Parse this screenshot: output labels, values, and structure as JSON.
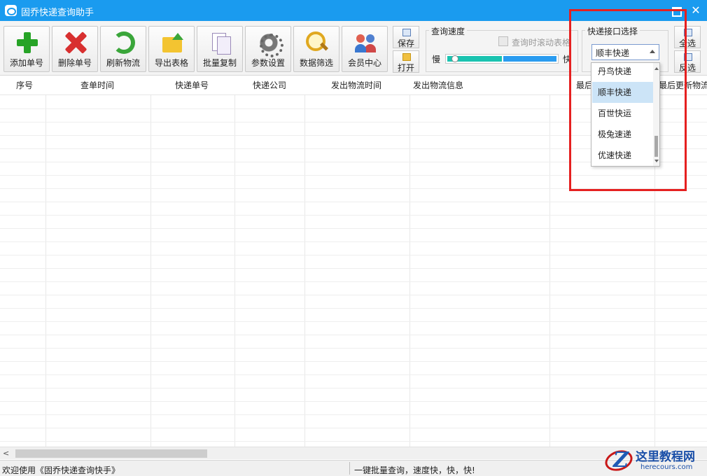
{
  "window": {
    "title": "固乔快递查询助手",
    "minimize_glyph": "",
    "maximize_glyph": "",
    "close_glyph": "✕"
  },
  "toolbar": {
    "buttons": [
      {
        "label": "添加单号",
        "icon": "add-icon"
      },
      {
        "label": "删除单号",
        "icon": "delete-icon"
      },
      {
        "label": "刷新物流",
        "icon": "refresh-icon"
      },
      {
        "label": "导出表格",
        "icon": "export-icon"
      },
      {
        "label": "批量复制",
        "icon": "copy-icon"
      },
      {
        "label": "参数设置",
        "icon": "gear-icon"
      },
      {
        "label": "数据筛选",
        "icon": "search-icon"
      },
      {
        "label": "会员中心",
        "icon": "member-icon"
      }
    ],
    "save_label": "保存",
    "open_label": "打开"
  },
  "query_speed": {
    "title": "查询速度",
    "scroll_checkbox_label": "查询时滚动表格",
    "scroll_checked": false,
    "slow_label": "慢",
    "fast_label": "快",
    "speed_fraction": 0.05
  },
  "courier_api": {
    "title": "快递接口选择",
    "selected": "顺丰快递",
    "options": [
      "丹鸟快递",
      "顺丰快递",
      "百世快运",
      "极兔速递",
      "优速快递"
    ],
    "select_all_label": "全选",
    "invert_label": "反选"
  },
  "table": {
    "columns": [
      "序号",
      "查单时间",
      "快递单号",
      "快递公司",
      "发出物流时间",
      "发出物流信息",
      "最后",
      "最后更新物流"
    ],
    "rows": []
  },
  "scrollbar": {
    "left_arrow": "<"
  },
  "status": {
    "left": "欢迎使用《固乔快递查询快手》",
    "right": "一键批量查询，速度快，快，快!"
  },
  "watermark": {
    "logo_letter": "Z",
    "title": "这里教程网",
    "url": "herecours.com"
  },
  "colors": {
    "title_bar": "#1a9bef",
    "highlight_box": "#e52020",
    "selected_option": "#cce4f7",
    "slider_fill": "#1ac3b0"
  }
}
